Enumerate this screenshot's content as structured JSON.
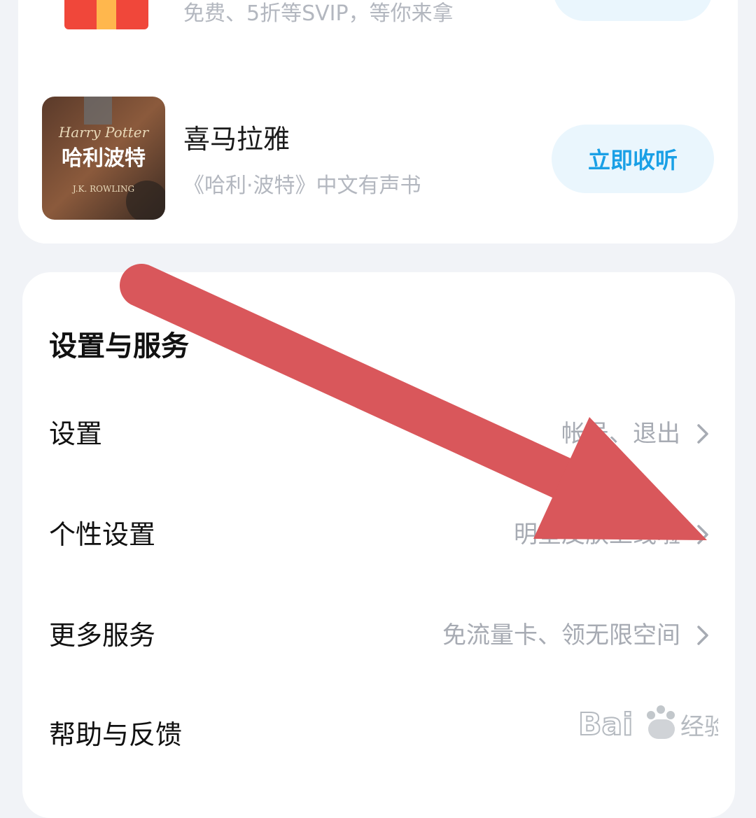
{
  "promo": {
    "gift_subtitle": "免费、5折等SVIP，等你来拿",
    "item": {
      "title": "喜马拉雅",
      "subtitle": "《哈利·波特》中文有声书",
      "button_label": "立即收听",
      "cover_icon": "harry-potter-cover-image"
    }
  },
  "settings": {
    "section_title": "设置与服务",
    "rows": [
      {
        "label": "设置",
        "value": "帐号、退出"
      },
      {
        "label": "个性设置",
        "value": "明星皮肤上线啦"
      },
      {
        "label": "更多服务",
        "value": "免流量卡、领无限空间"
      },
      {
        "label": "帮助与反馈",
        "value": ""
      }
    ]
  },
  "colors": {
    "accent": "#1aa0e6",
    "arrow": "#d9575b",
    "background": "#f1f3f7"
  }
}
